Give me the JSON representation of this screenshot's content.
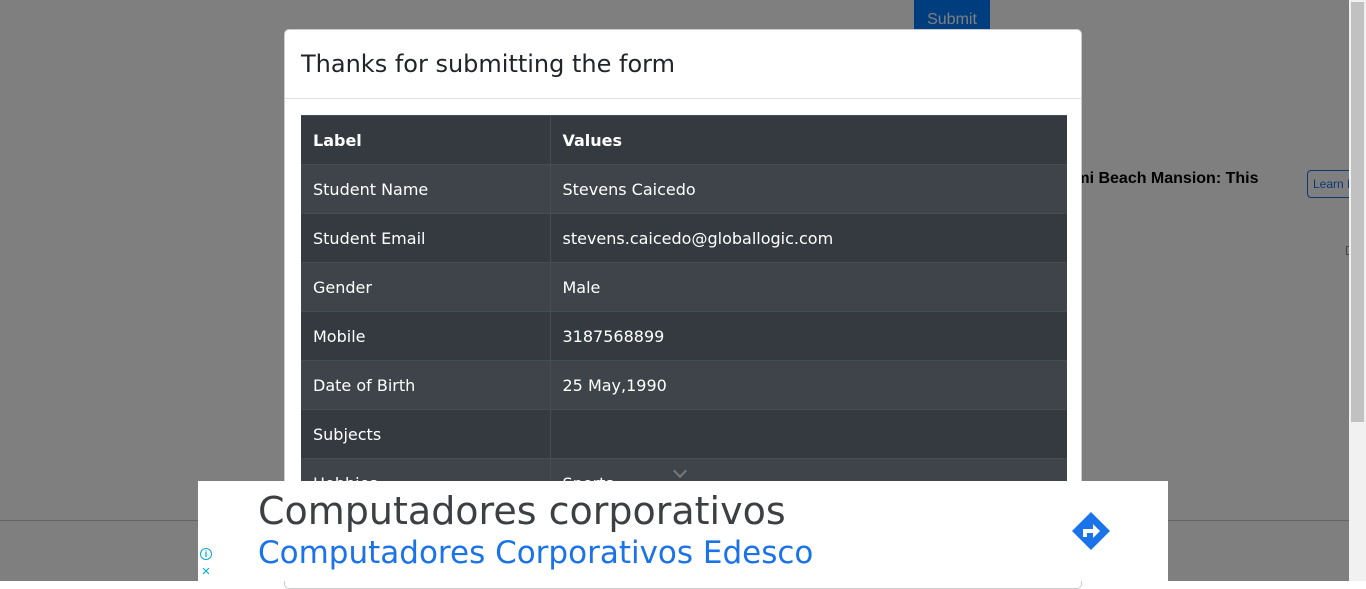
{
  "background": {
    "submit_label": "Submit",
    "ad_headline": "iami Beach Mansion: This",
    "learn_more_label": "Learn M"
  },
  "modal": {
    "title": "Thanks for submitting the form",
    "table": {
      "headers": [
        "Label",
        "Values"
      ],
      "rows": [
        {
          "label": "Student Name",
          "value": "Stevens Caicedo"
        },
        {
          "label": "Student Email",
          "value": "stevens.caicedo@globallogic.com"
        },
        {
          "label": "Gender",
          "value": "Male"
        },
        {
          "label": "Mobile",
          "value": "3187568899"
        },
        {
          "label": "Date of Birth",
          "value": "25 May,1990"
        },
        {
          "label": "Subjects",
          "value": ""
        },
        {
          "label": "Hobbies",
          "value": "Sports"
        }
      ]
    }
  },
  "ad": {
    "title": "Computadores corporativos",
    "subtitle": "Computadores Corporativos Edesco",
    "info_icon": "info-icon",
    "close_icon": "close-icon",
    "directions_icon": "directions-icon",
    "colors": {
      "title": "#3c4043",
      "subtitle": "#1a73e8",
      "icon": "#1a73e8"
    }
  }
}
